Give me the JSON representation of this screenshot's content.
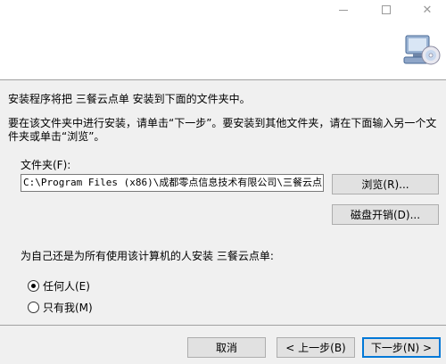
{
  "window": {
    "minimize_icon": "minimize-icon",
    "maximize_icon": "maximize-icon",
    "close_glyph": "✕"
  },
  "header": {
    "icon": "installer-computer-cd-icon"
  },
  "body": {
    "line1": "安装程序将把 三餐云点单 安装到下面的文件夹中。",
    "line2": "要在该文件夹中进行安装，请单击“下一步”。要安装到其他文件夹，请在下面输入另一个文件夹或单击“浏览”。"
  },
  "folder": {
    "label": "文件夹(F):",
    "value": "C:\\Program Files (x86)\\成都零点信息技术有限公司\\三餐云点",
    "browse_label": "浏览(R)...",
    "disk_cost_label": "磁盘开销(D)..."
  },
  "scope": {
    "label": "为自己还是为所有使用该计算机的人安装 三餐云点单:",
    "options": [
      {
        "label": "任何人(E)",
        "checked": true
      },
      {
        "label": "只有我(M)",
        "checked": false
      }
    ]
  },
  "footer": {
    "cancel_label": "取消",
    "prev_label": "< 上一步(B)",
    "next_label": "下一步(N) >"
  }
}
